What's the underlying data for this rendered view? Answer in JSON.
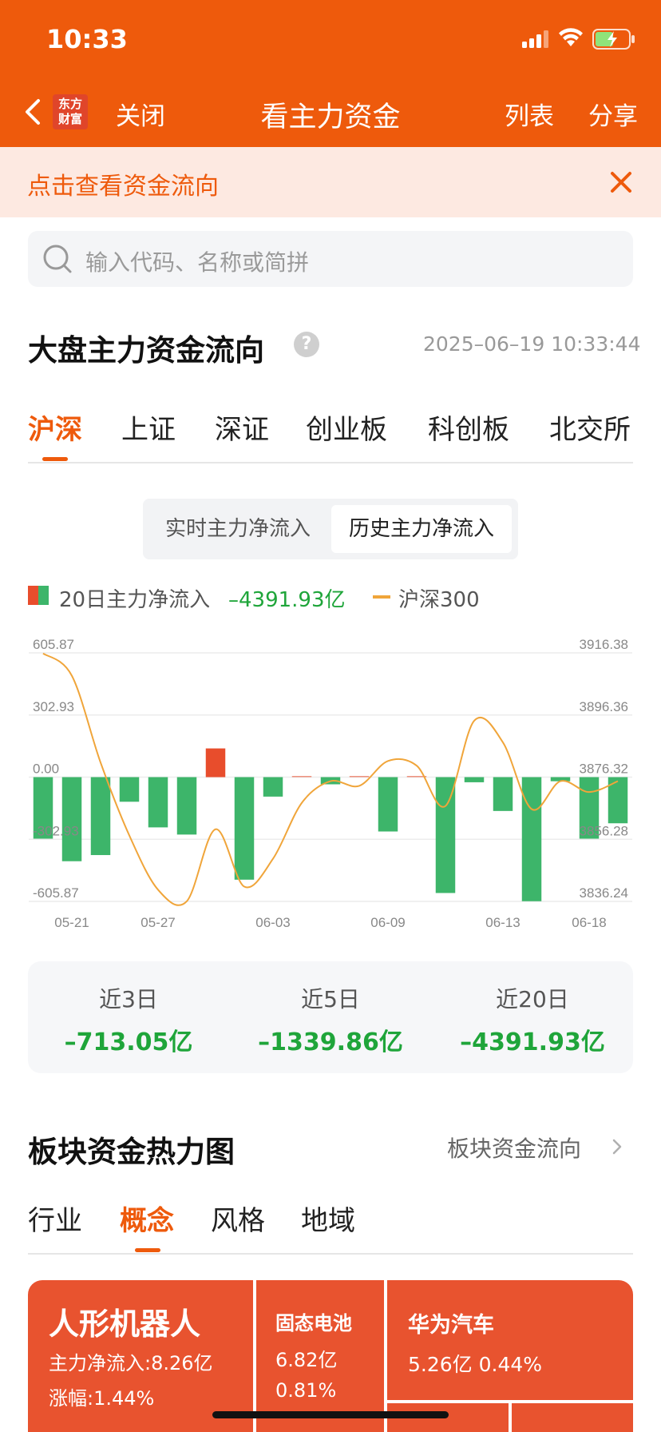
{
  "status": {
    "time": "10:33"
  },
  "nav": {
    "logo_line1": "东方",
    "logo_line2": "财富",
    "close": "关闭",
    "title": "看主力资金",
    "list": "列表",
    "share": "分享"
  },
  "banner": {
    "text": "点击查看资金流向"
  },
  "search": {
    "placeholder": "输入代码、名称或简拼"
  },
  "section": {
    "title": "大盘主力资金流向",
    "help": "?",
    "datetime": "2025–06–19 10:33:44"
  },
  "market_tabs": [
    "沪深",
    "上证",
    "深证",
    "创业板",
    "科创板",
    "北交所"
  ],
  "segment": {
    "realtime": "实时主力净流入",
    "history": "历史主力净流入"
  },
  "legend": {
    "flow_label": "20日主力净流入",
    "flow_value": "–4391.93亿",
    "index_label": "沪深300"
  },
  "colors": {
    "brand": "#ee5a0c",
    "inflow": "#e84d2c",
    "outflow": "#3db56a",
    "index_line": "#f0a53a",
    "down_text": "#1fa53a"
  },
  "chart_data": {
    "type": "bar",
    "categories": [
      "05-21",
      "05-22",
      "05-23",
      "05-26",
      "05-27",
      "05-28",
      "05-29",
      "05-30",
      "06-03",
      "06-04",
      "06-05",
      "06-06",
      "06-09",
      "06-10",
      "06-11",
      "06-12",
      "06-13",
      "06-16",
      "06-17",
      "06-18",
      "06-19"
    ],
    "x_tick_labels": [
      "05-21",
      "05-27",
      "06-03",
      "06-09",
      "06-13",
      "06-18"
    ],
    "x_tick_indices": [
      1,
      4,
      8,
      12,
      16,
      19
    ],
    "series": [
      {
        "name": "20日主力净流入",
        "type": "bar",
        "values": [
          -300,
          -410,
          -380,
          -120,
          -245,
          -280,
          140,
          -500,
          -95,
          0,
          -35,
          0,
          -265,
          0,
          -565,
          -25,
          -165,
          -605,
          -20,
          -300,
          -225
        ]
      },
      {
        "name": "沪深300",
        "type": "line",
        "values": [
          3916.2,
          3909,
          3881,
          3857.5,
          3840,
          3836.3,
          3859.5,
          3841,
          3850,
          3868,
          3875,
          3873.5,
          3881.5,
          3880,
          3867,
          3894.5,
          3887.5,
          3866,
          3875,
          3871.5,
          3875
        ]
      }
    ],
    "y_left_ticks": [
      "605.87",
      "302.93",
      "0.00",
      "-302.93",
      "-605.87"
    ],
    "y_left_range": [
      -605.87,
      605.87
    ],
    "y_right_ticks": [
      "3916.38",
      "3896.36",
      "3876.32",
      "3856.28",
      "3836.24"
    ],
    "y_right_range": [
      3836.24,
      3916.38
    ]
  },
  "summary": [
    {
      "label": "近3日",
      "value": "–713.05亿"
    },
    {
      "label": "近5日",
      "value": "–1339.86亿"
    },
    {
      "label": "近20日",
      "value": "–4391.93亿"
    }
  ],
  "heat": {
    "title": "板块资金热力图",
    "link": "板块资金流向",
    "tabs": [
      "行业",
      "概念",
      "风格",
      "地域"
    ],
    "tiles": [
      {
        "name": "人形机器人",
        "line2": "主力净流入:8.26亿",
        "line3": "涨幅:1.44%"
      },
      {
        "name": "固态电池",
        "line2": "6.82亿",
        "line3": "0.81%"
      },
      {
        "name": "华为汽车",
        "line2": "5.26亿  0.44%"
      }
    ]
  }
}
